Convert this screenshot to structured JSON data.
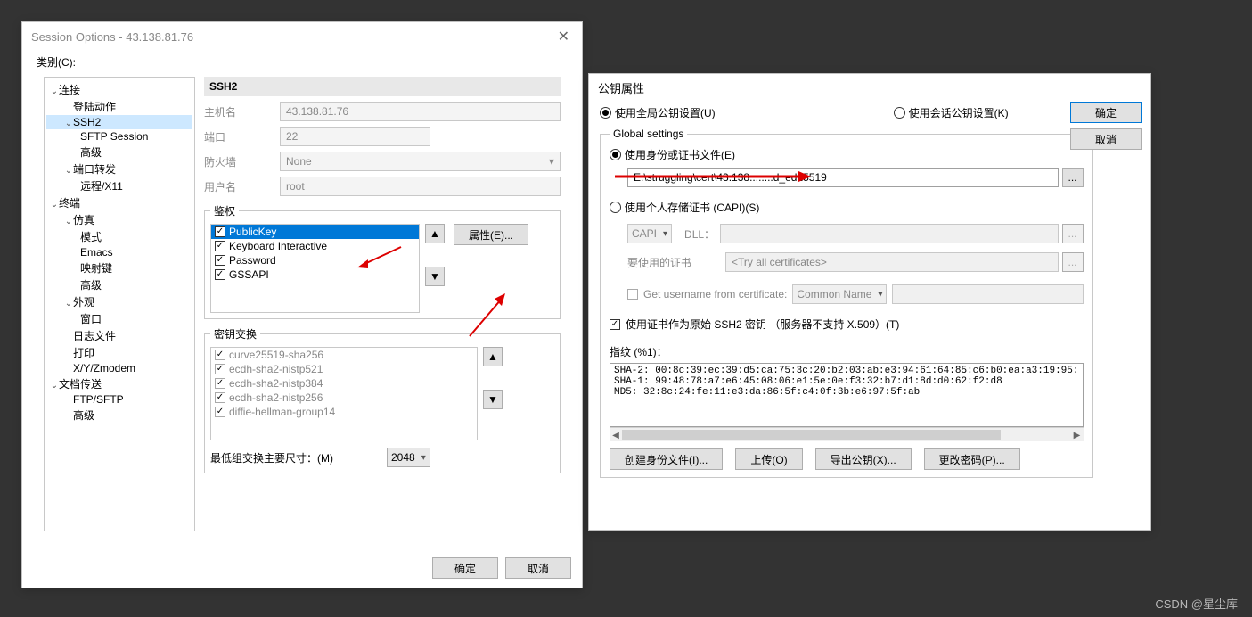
{
  "session": {
    "title": "Session Options - 43.138.81.76",
    "categoryLabel": "类别(C):",
    "tree": {
      "connection": "连接",
      "loginAction": "登陆动作",
      "ssh2": "SSH2",
      "sftpSession": "SFTP Session",
      "advanced1": "高级",
      "portFwd": "端口转发",
      "remoteX11": "远程/X11",
      "terminal": "终端",
      "emulation": "仿真",
      "mode": "模式",
      "emacs": "Emacs",
      "mapKeys": "映射键",
      "advanced2": "高级",
      "appearance": "外观",
      "window": "窗口",
      "logFile": "日志文件",
      "print": "打印",
      "xyzModem": "X/Y/Zmodem",
      "docTransfer": "文档传送",
      "ftpSftp": "FTP/SFTP",
      "advanced3": "高级"
    },
    "header": "SSH2",
    "hostLabel": "主机名",
    "hostValue": "43.138.81.76",
    "portLabel": "端口",
    "portValue": "22",
    "firewallLabel": "防火墙",
    "firewallValue": "None",
    "userLabel": "用户名",
    "userValue": "root",
    "authLegend": "鉴权",
    "authItems": [
      "PublicKey",
      "Keyboard Interactive",
      "Password",
      "GSSAPI"
    ],
    "propsBtn": "属性(E)...",
    "kexLegend": "密钥交换",
    "kexItems": [
      "curve25519-sha256",
      "ecdh-sha2-nistp521",
      "ecdh-sha2-nistp384",
      "ecdh-sha2-nistp256",
      "diffie-hellman-group14"
    ],
    "minKexLabel": "最低组交换主要尺寸：(M)",
    "minKexValue": "2048",
    "okBtn": "确定",
    "cancelBtn": "取消"
  },
  "pk": {
    "title": "公钥属性",
    "useGlobal": "使用全局公钥设置(U)",
    "useSession": "使用会话公钥设置(K)",
    "okBtn": "确定",
    "cancelBtn": "取消",
    "globalLegend": "Global settings",
    "useIdentity": "使用身份或证书文件(E)",
    "identityValue": "E:\\struggling\\cert\\43.138........d_ed25519",
    "useCapi": "使用个人存储证书 (CAPI)(S)",
    "capiLabel": "CAPI",
    "dllLabel": "DLL：",
    "certLabel": "要使用的证书",
    "certPlaceholder": "<Try all certificates>",
    "getUser": "Get username from certificate:",
    "commonName": "Common Name",
    "useCertAsKey": "使用证书作为原始 SSH2 密钥 （服务器不支持 X.509）(T)",
    "fingerprintLabel": "指纹 (%1)：",
    "fpSha2": "SHA-2: 00:8c:39:ec:39:d5:ca:75:3c:20:b2:03:ab:e3:94:61:64:85:c6:b0:ea:a3:19:95:",
    "fpSha1": "SHA-1: 99:48:78:a7:e6:45:08:06:e1:5e:0e:f3:32:b7:d1:8d:d0:62:f2:d8",
    "fpMd5": "MD5: 32:8c:24:fe:11:e3:da:86:5f:c4:0f:3b:e6:97:5f:ab",
    "createIdentity": "创建身份文件(I)...",
    "upload": "上传(O)",
    "exportKey": "导出公钥(X)...",
    "changePwd": "更改密码(P)..."
  },
  "watermark": "CSDN @星尘库"
}
